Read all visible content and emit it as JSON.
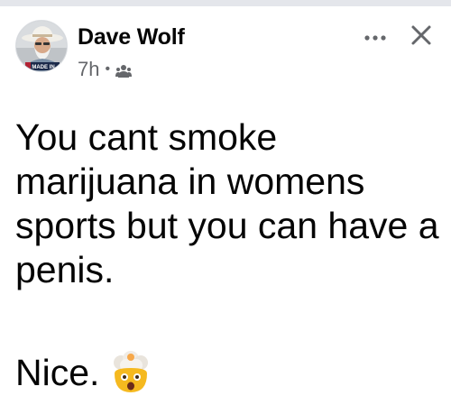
{
  "post": {
    "author": "Dave Wolf",
    "time": "7h",
    "separator": "•",
    "audience_icon": "friends-icon",
    "avatar_badge": "MADE IN",
    "text": "You cant smoke marijuana in womens sports but you can have a penis.",
    "text2": "Nice.",
    "emoji": "exploding-head-emoji"
  },
  "actions": {
    "more_icon": "more-horizontal-icon",
    "close_icon": "close-icon"
  },
  "colors": {
    "text": "#050505",
    "secondary": "#65676b",
    "strip": "#e4e6eb"
  }
}
